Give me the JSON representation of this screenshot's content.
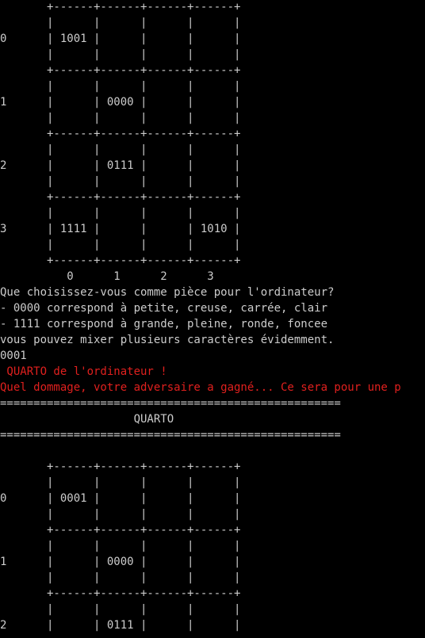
{
  "window": {
    "text_color": "#cccccc",
    "alert_color": "#e0201e",
    "background": "#000000"
  },
  "lines": [
    {
      "text": "       +------+------+------+------+",
      "red": false
    },
    {
      "text": "       |      |      |      |      |",
      "red": false
    },
    {
      "text": "0      | 1001 |      |      |      |",
      "red": false
    },
    {
      "text": "       |      |      |      |      |",
      "red": false
    },
    {
      "text": "       +------+------+------+------+",
      "red": false
    },
    {
      "text": "       |      |      |      |      |",
      "red": false
    },
    {
      "text": "1      |      | 0000 |      |      |",
      "red": false
    },
    {
      "text": "       |      |      |      |      |",
      "red": false
    },
    {
      "text": "       +------+------+------+------+",
      "red": false
    },
    {
      "text": "       |      |      |      |      |",
      "red": false
    },
    {
      "text": "2      |      | 0111 |      |      |",
      "red": false
    },
    {
      "text": "       |      |      |      |      |",
      "red": false
    },
    {
      "text": "       +------+------+------+------+",
      "red": false
    },
    {
      "text": "       |      |      |      |      |",
      "red": false
    },
    {
      "text": "3      | 1111 |      |      | 1010 |",
      "red": false
    },
    {
      "text": "       |      |      |      |      |",
      "red": false
    },
    {
      "text": "       +------+------+------+------+",
      "red": false
    },
    {
      "text": "          0      1      2      3",
      "red": false
    },
    {
      "text": "Que choisissez-vous comme pièce pour l'ordinateur?",
      "red": false
    },
    {
      "text": "- 0000 correspond à petite, creuse, carrée, clair",
      "red": false
    },
    {
      "text": "- 1111 correspond à grande, pleine, ronde, foncee",
      "red": false
    },
    {
      "text": "vous pouvez mixer plusieurs caractères évidemment.",
      "red": false
    },
    {
      "text": "0001",
      "red": false
    },
    {
      "text": " QUARTO de l'ordinateur !",
      "red": true
    },
    {
      "text": "Quel dommage, votre adversaire a gagné... Ce sera pour une p",
      "red": true
    },
    {
      "text": "===================================================",
      "red": false
    },
    {
      "text": "                    QUARTO",
      "red": false
    },
    {
      "text": "===================================================",
      "red": false
    },
    {
      "text": "",
      "red": false
    },
    {
      "text": "       +------+------+------+------+",
      "red": false
    },
    {
      "text": "       |      |      |      |      |",
      "red": false
    },
    {
      "text": "0      | 0001 |      |      |      |",
      "red": false
    },
    {
      "text": "       |      |      |      |      |",
      "red": false
    },
    {
      "text": "       +------+------+------+------+",
      "red": false
    },
    {
      "text": "       |      |      |      |      |",
      "red": false
    },
    {
      "text": "1      |      | 0000 |      |      |",
      "red": false
    },
    {
      "text": "       |      |      |      |      |",
      "red": false
    },
    {
      "text": "       +------+------+------+------+",
      "red": false
    },
    {
      "text": "       |      |      |      |      |",
      "red": false
    },
    {
      "text": "2      |      | 0111 |      |      |",
      "red": false
    }
  ]
}
